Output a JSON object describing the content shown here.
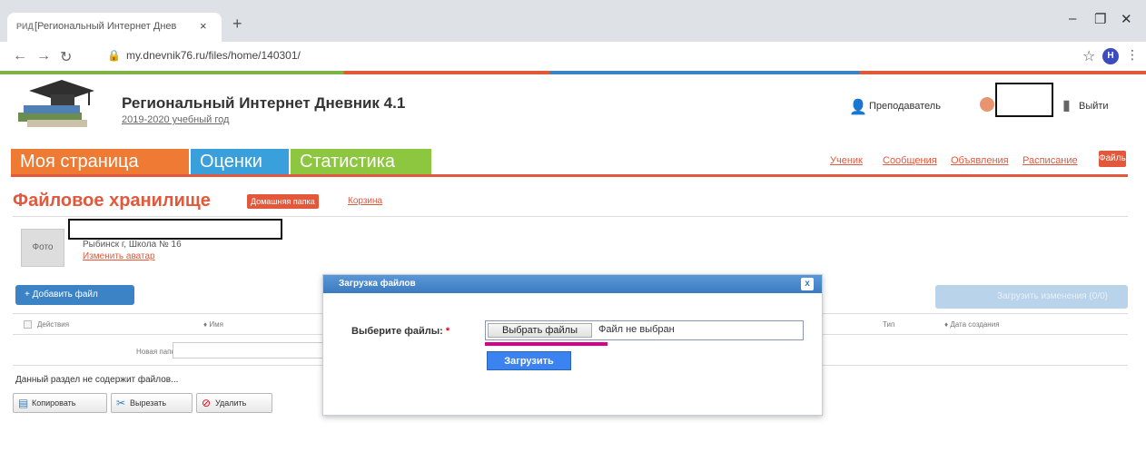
{
  "browser": {
    "tab_favicon": "РИД",
    "tab_title": "[Региональный Интернет Днев",
    "tab_close": "×",
    "new_tab": "+",
    "url": "my.dnevnik76.ru/files/home/140301/",
    "profile_initial": "Н",
    "win_min": "–",
    "win_max": "❐",
    "win_close": "✕"
  },
  "header": {
    "title": "Региональный Интернет Дневник 4.1",
    "year": "2019-2020 учебный год",
    "role": "Преподаватель",
    "exit": "Выйти"
  },
  "nav": {
    "main": [
      "Моя страница",
      "Оценки",
      "Статистика"
    ],
    "sub": [
      "Ученик",
      "Сообщения",
      "Объявления",
      "Расписание"
    ],
    "files": "Файлы"
  },
  "page": {
    "title": "Файловое хранилище",
    "home_folder": "Домашняя папка",
    "trash": "Корзина",
    "photo": "Фото",
    "school": "Рыбинск г, Школа № 16",
    "change_photo": "Изменить аватар",
    "add_file": "Добавить файл",
    "upload_changes": "Загрузить изменения (0/0)",
    "table_headers": {
      "actions": "Действия",
      "name": "Имя",
      "type": "Тип",
      "created": "Дата создания"
    },
    "new_folder": "Новая папка",
    "empty": "Данный раздел не содержит файлов...",
    "actions": [
      "Копировать",
      "Вырезать",
      "Удалить"
    ]
  },
  "modal": {
    "title": "Загрузка файлов",
    "close": "x",
    "label": "Выберите файлы:",
    "required_mark": "*",
    "choose_btn": "Выбрать файлы",
    "status": "Файл не выбран",
    "upload": "Загрузить"
  },
  "colors": {
    "accent_orange": "#ef7a34",
    "accent_blue": "#3aa0db",
    "accent_green": "#8dc63f",
    "brand_red": "#e3573b",
    "highlight_pink": "#d6008a"
  }
}
